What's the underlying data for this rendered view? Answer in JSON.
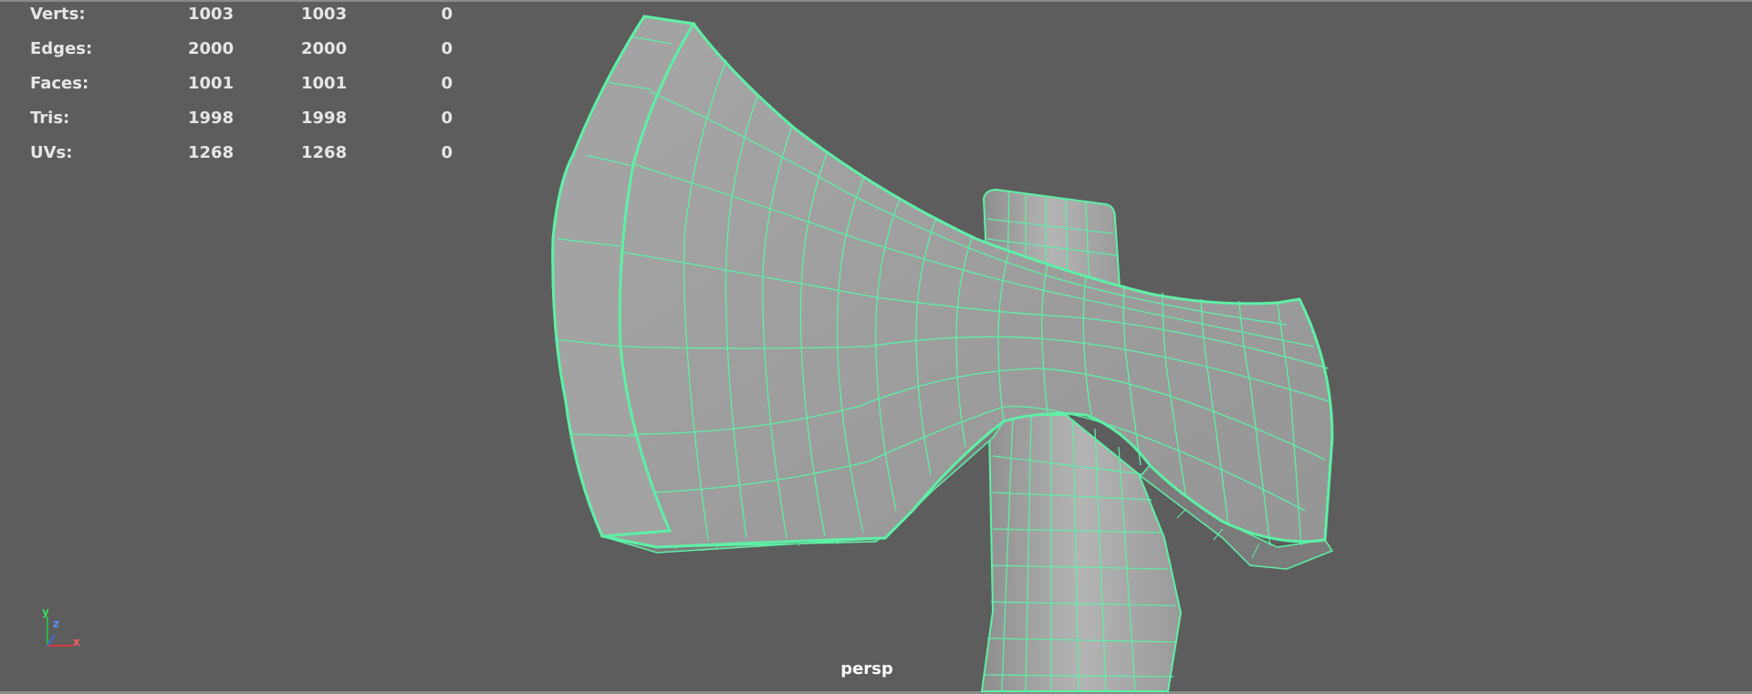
{
  "hud": {
    "rows": [
      {
        "label": "Verts:",
        "c1": "1003",
        "c2": "1003",
        "c3": "0"
      },
      {
        "label": "Edges:",
        "c1": "2000",
        "c2": "2000",
        "c3": "0"
      },
      {
        "label": "Faces:",
        "c1": "1001",
        "c2": "1001",
        "c3": "0"
      },
      {
        "label": "Tris:",
        "c1": "1998",
        "c2": "1998",
        "c3": "0"
      },
      {
        "label": "UVs:",
        "c1": "1268",
        "c2": "1268",
        "c3": "0"
      }
    ]
  },
  "camera": {
    "label": "persp"
  },
  "axis": {
    "y": "y",
    "z": "z",
    "x": "x"
  },
  "colors": {
    "background": "#5d5d5d",
    "wireframe": "#5ef0a5",
    "mesh_face": "#9d9d9d",
    "mesh_face_dark": "#7b7b7b",
    "hud_text": "#e6e6e6"
  }
}
